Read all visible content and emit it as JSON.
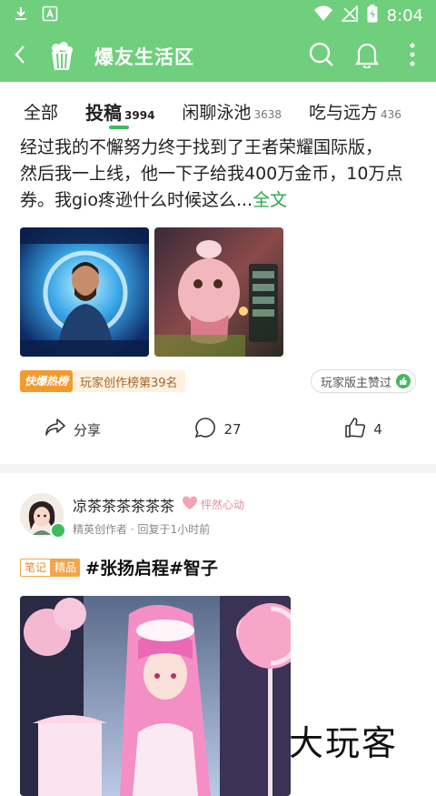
{
  "status_bar": {
    "time": "8:04",
    "icons": [
      "download-icon",
      "notification-a-icon",
      "wifi-icon",
      "no-signal-icon",
      "battery-charging-icon"
    ]
  },
  "app_bar": {
    "title": "爆友生活区",
    "icons": [
      "back-arrow-icon",
      "popcorn-logo-icon",
      "search-icon",
      "bell-icon",
      "more-vertical-icon"
    ],
    "background_color": "#6fcf7c"
  },
  "tabs": [
    {
      "label": "全部",
      "count": ""
    },
    {
      "label": "投稿",
      "count": "3994"
    },
    {
      "label": "闲聊泳池",
      "count": "3638"
    },
    {
      "label": "吃与远方",
      "count": "436"
    }
  ],
  "active_tab": "投稿",
  "post1": {
    "text_lines": [
      "经过我的不懈努力终于找到了王者荣耀国际版，",
      "然后我一上线，他一下子给我400万金币，10万点",
      "券。我gio疼逊什么时候这么..."
    ],
    "more_label": "全文",
    "hot_badge": "快爆热榜",
    "rank_text": "玩家创作榜第39名",
    "liked_text": "玩家版主赞过",
    "share_label": "分享",
    "comment_count": "27",
    "like_count": "4"
  },
  "post2": {
    "author_name": "凉茶茶茶茶茶茶",
    "heart_tag": "怦然心动",
    "author_role": "精英创作者",
    "reply_time": "回复于1小时前",
    "tag_note": "笔记",
    "tag_best": "精品",
    "title": "#张扬启程#智子"
  },
  "watermark": "大玩客",
  "accent_color": "#3fbb5b"
}
